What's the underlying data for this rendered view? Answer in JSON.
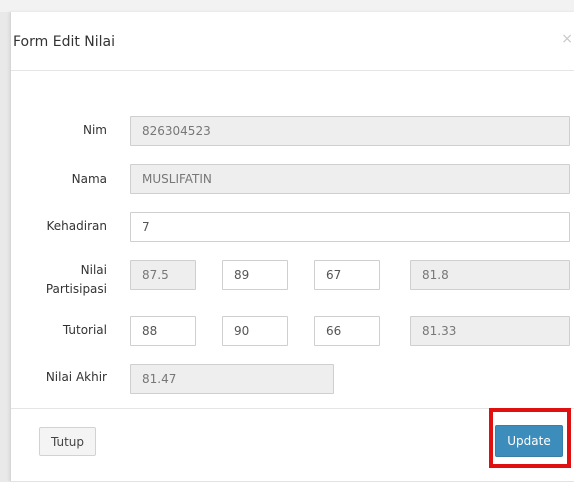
{
  "modal": {
    "title": "Form Edit Nilai",
    "close_glyph": "×"
  },
  "form": {
    "nim": {
      "label": "Nim",
      "value": "826304523"
    },
    "nama": {
      "label": "Nama",
      "value": "MUSLIFATIN"
    },
    "kehadiran": {
      "label": "Kehadiran",
      "value": "7"
    },
    "partisipasi": {
      "label_line1": "Nilai",
      "label_line2": "Partisipasi",
      "values": [
        "87.5",
        "89",
        "67",
        "81.8"
      ]
    },
    "tutorial": {
      "label": "Tutorial",
      "values": [
        "88",
        "90",
        "66",
        "81.33"
      ]
    },
    "nilai_akhir": {
      "label": "Nilai Akhir",
      "value": "81.47"
    }
  },
  "footer": {
    "close_label": "Tutup",
    "update_label": "Update"
  },
  "colors": {
    "primary": "#3c8dbc",
    "highlight": "#e01010",
    "readonly_bg": "#eeeeee"
  }
}
